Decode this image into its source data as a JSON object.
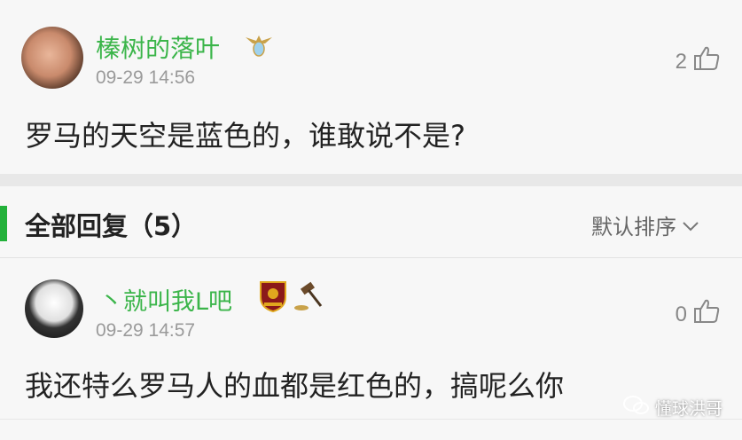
{
  "post": {
    "username": "榛树的落叶",
    "timestamp": "09-29 14:56",
    "content": "罗马的天空是蓝色的，谁敢说不是?",
    "like_count": "2"
  },
  "replies_header": {
    "title": "全部回复（5）",
    "sort_label": "默认排序"
  },
  "reply": {
    "username": "丶就叫我L吧",
    "timestamp": "09-29 14:57",
    "content": "我还特么罗马人的血都是红色的，搞呢么你",
    "like_count": "0"
  },
  "watermark": "懂球洪哥",
  "colors": {
    "username_green": "#3bb54a",
    "accent_green": "#23b13a"
  }
}
